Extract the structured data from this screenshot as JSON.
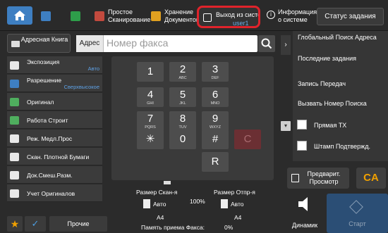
{
  "topbar": {
    "apps": [
      {
        "label": "",
        "icon": "scanner-icon",
        "color": "#3e7fc2"
      },
      {
        "label": "",
        "icon": "copy-icon",
        "color": "#2e9e4a"
      },
      {
        "label": "Простое Сканирование",
        "icon": "simple-scan-icon",
        "color": "#c24a3e"
      },
      {
        "label": "Хранение Документов",
        "icon": "document-storage-icon",
        "color": "#e0a020"
      }
    ],
    "logout_label": "Выход из системы",
    "logout_user": "user1",
    "info_label": "Информация о системе",
    "status_label": "Статус задания"
  },
  "address": {
    "book_label": "Адресная Книга",
    "field_label": "Адрес",
    "placeholder": "Номер факса"
  },
  "features": [
    {
      "name": "Экспозиция",
      "value": "Авто",
      "color": "#e8e8e8"
    },
    {
      "name": "Разрешение",
      "value": "Сверхвысокое",
      "color": "#3e7fc2"
    },
    {
      "name": "Оригинал",
      "value": "",
      "color": "#4fae5e"
    },
    {
      "name": "Работа Строит",
      "value": "",
      "color": "#4fae5e"
    },
    {
      "name": "Реж. Медл.Прос",
      "value": "",
      "color": "#e8e8e8"
    },
    {
      "name": "Скан. Плотной Бумаги",
      "value": "",
      "color": "#e8e8e8"
    },
    {
      "name": "Док.Смеш.Разм.",
      "value": "",
      "color": "#e8e8e8"
    },
    {
      "name": "Учет Оригиналов",
      "value": "",
      "color": "#e8e8e8"
    }
  ],
  "bottom_left": {
    "star": "★",
    "check": "✓",
    "other_label": "Прочие"
  },
  "keypad": [
    {
      "digit": "1",
      "sub": ""
    },
    {
      "digit": "2",
      "sub": "ABC"
    },
    {
      "digit": "3",
      "sub": "DEF"
    },
    {
      "digit": "4",
      "sub": "GHI"
    },
    {
      "digit": "5",
      "sub": "JKL"
    },
    {
      "digit": "6",
      "sub": "MNO"
    },
    {
      "digit": "7",
      "sub": "PQRS"
    },
    {
      "digit": "8",
      "sub": "TUV"
    },
    {
      "digit": "9",
      "sub": "WXYZ"
    },
    {
      "digit": "✳",
      "sub": ""
    },
    {
      "digit": "0",
      "sub": ""
    },
    {
      "digit": "#",
      "sub": ""
    },
    {
      "digit": "C",
      "sub": ""
    },
    {
      "digit": "R",
      "sub": ""
    }
  ],
  "info": {
    "scan_size_label": "Размер Скан-я",
    "send_size_label": "Размер Отпр-я",
    "ratio": "100%",
    "scan_size_value": "Авто",
    "send_size_value": "Авто",
    "scan_paper": "A4",
    "send_paper": "A4",
    "memory_label": "Память приема Факса:",
    "memory_value": "0%"
  },
  "right_panel": {
    "expander": "›",
    "global_search": "Глобальный Поиск Адреса",
    "recent_jobs": "Последние задания",
    "send_log": "Запись Передач",
    "call_number": "Вызвать Номер Поиска",
    "direct_tx": "Прямая TX",
    "stamp": "Штамп Подтвержд.",
    "chevron": "▾"
  },
  "actions": {
    "preview_label": "Предварит. Просмотр",
    "ca_label": "CA",
    "speaker_label": "Динамик",
    "start_label": "Старт"
  }
}
